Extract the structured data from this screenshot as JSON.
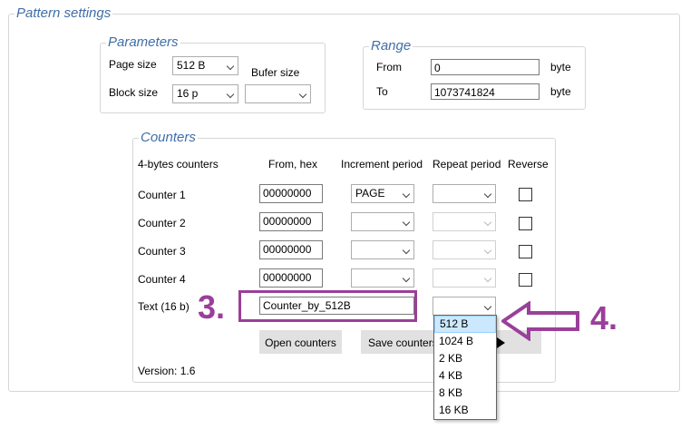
{
  "pattern_settings": {
    "title": "Pattern settings"
  },
  "parameters": {
    "title": "Parameters",
    "page_size_label": "Page size",
    "page_size_value": "512 B",
    "block_size_label": "Block size",
    "block_size_value": "16 p",
    "bufer_size_label": "Bufer size",
    "bufer_size_value": ""
  },
  "range": {
    "title": "Range",
    "from_label": "From",
    "from_value": "0",
    "from_unit": "byte",
    "to_label": "To",
    "to_value": "1073741824",
    "to_unit": "byte"
  },
  "counters": {
    "title": "Counters",
    "headers": {
      "name": "4-bytes counters",
      "from": "From, hex",
      "increment": "Increment period",
      "repeat": "Repeat period",
      "reverse": "Reverse"
    },
    "rows": [
      {
        "label": "Counter 1",
        "from": "00000000",
        "increment": "PAGE",
        "repeat": ""
      },
      {
        "label": "Counter 2",
        "from": "00000000",
        "increment": "",
        "repeat": ""
      },
      {
        "label": "Counter 3",
        "from": "00000000",
        "increment": "",
        "repeat": ""
      },
      {
        "label": "Counter 4",
        "from": "00000000",
        "increment": "",
        "repeat": ""
      }
    ],
    "text_label": "Text (16 b)",
    "text_value": "Counter_by_512B",
    "text_repeat": "",
    "open_button": "Open counters",
    "save_button": "Save counters",
    "version": "Version: 1.6"
  },
  "dropdown": {
    "options": [
      "512 B",
      "1024 B",
      "2 KB",
      "4 KB",
      "8 KB",
      "16 KB"
    ],
    "selected_index": 0
  },
  "annotations": {
    "step3": "3.",
    "step4": "4.",
    "color": "#9a3f9a"
  }
}
